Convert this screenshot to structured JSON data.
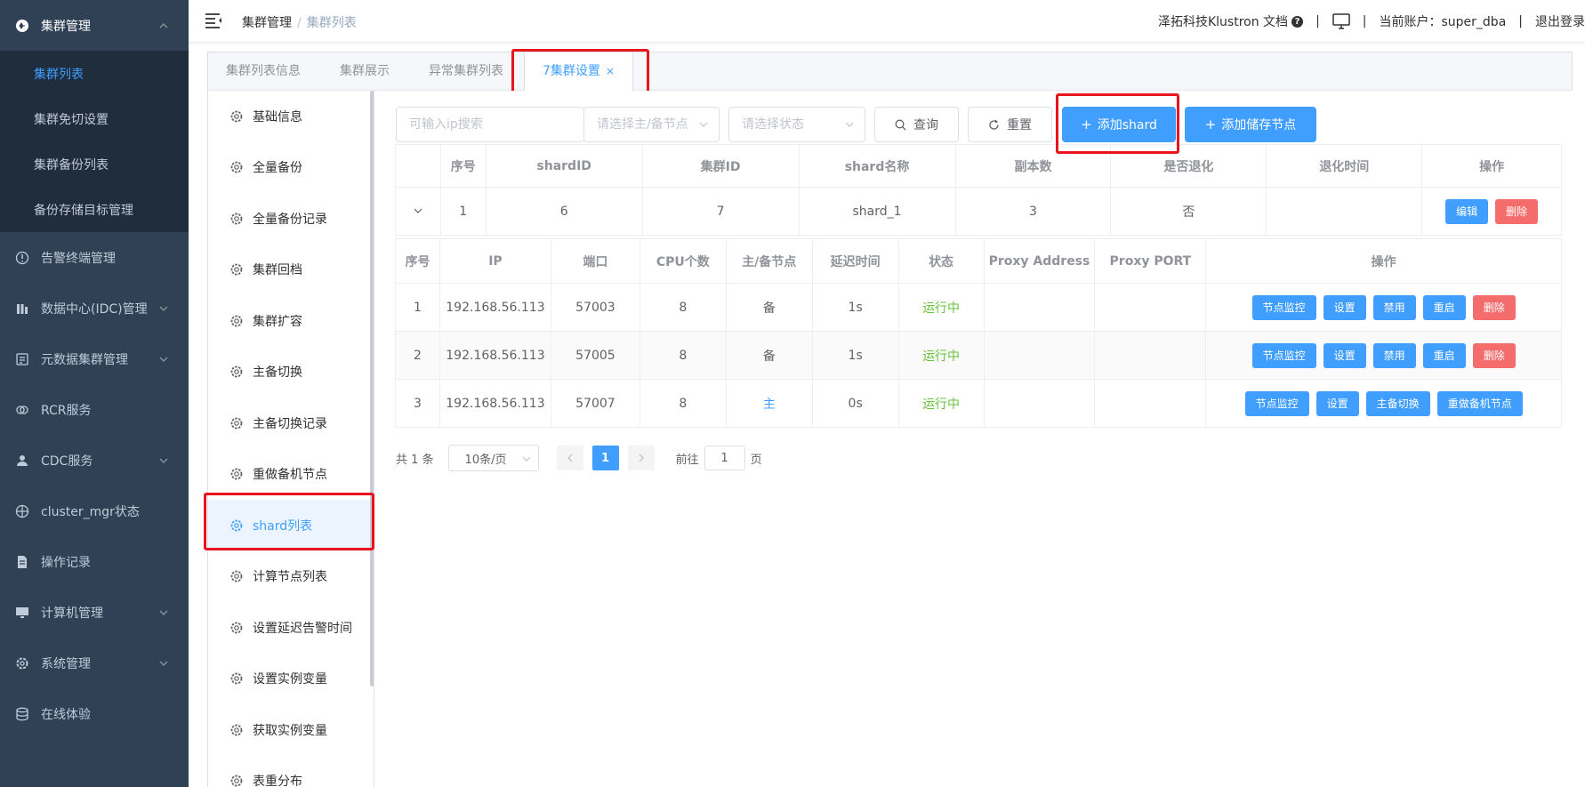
{
  "sidebar": {
    "top_menu": {
      "label": "集群管理",
      "icon": "cluster-icon"
    },
    "sub_items": [
      {
        "label": "集群列表",
        "active": true
      },
      {
        "label": "集群免切设置",
        "active": false
      },
      {
        "label": "集群备份列表",
        "active": false
      },
      {
        "label": "备份存储目标管理",
        "active": false
      }
    ],
    "items": [
      {
        "label": "告警终端管理",
        "icon": "alert-icon",
        "has_arrow": false
      },
      {
        "label": "数据中心(IDC)管理",
        "icon": "datacenter-icon",
        "has_arrow": true
      },
      {
        "label": "元数据集群管理",
        "icon": "metadata-icon",
        "has_arrow": true
      },
      {
        "label": "RCR服务",
        "icon": "link-icon",
        "has_arrow": false
      },
      {
        "label": "CDC服务",
        "icon": "user-icon",
        "has_arrow": true
      },
      {
        "label": "cluster_mgr状态",
        "icon": "target-icon",
        "has_arrow": false
      },
      {
        "label": "操作记录",
        "icon": "document-icon",
        "has_arrow": false
      },
      {
        "label": "计算机管理",
        "icon": "monitor-icon",
        "has_arrow": true
      },
      {
        "label": "系统管理",
        "icon": "settings-icon",
        "has_arrow": true
      },
      {
        "label": "在线体验",
        "icon": "database-icon",
        "has_arrow": false
      }
    ]
  },
  "header": {
    "breadcrumb_main": "集群管理",
    "breadcrumb_sep": "/",
    "breadcrumb_current": "集群列表",
    "docs_label": "泽拓科技Klustron 文档",
    "help_glyph": "?",
    "divider": "|",
    "account_label": "当前账户：super_dba",
    "logout_label": "退出登录"
  },
  "tabs": [
    {
      "label": "集群列表信息",
      "active": false
    },
    {
      "label": "集群展示",
      "active": false
    },
    {
      "label": "异常集群列表",
      "active": false
    },
    {
      "label": "7集群设置",
      "active": true,
      "close": "×"
    }
  ],
  "inner_menu": [
    {
      "label": "基础信息",
      "active": false
    },
    {
      "label": "全量备份",
      "active": false
    },
    {
      "label": "全量备份记录",
      "active": false
    },
    {
      "label": "集群回档",
      "active": false
    },
    {
      "label": "集群扩容",
      "active": false
    },
    {
      "label": "主备切换",
      "active": false
    },
    {
      "label": "主备切换记录",
      "active": false
    },
    {
      "label": "重做备机节点",
      "active": false
    },
    {
      "label": "shard列表",
      "active": true
    },
    {
      "label": "计算节点列表",
      "active": false
    },
    {
      "label": "设置延迟告警时间",
      "active": false
    },
    {
      "label": "设置实例变量",
      "active": false
    },
    {
      "label": "获取实例变量",
      "active": false
    },
    {
      "label": "表重分布",
      "active": false
    }
  ],
  "toolbar": {
    "ip_placeholder": "可输入ip搜索",
    "node_type_placeholder": "请选择主/备节点",
    "status_placeholder": "请选择状态",
    "query_label": "查询",
    "reset_label": "重置",
    "add_shard_label": "添加shard",
    "add_storage_label": "添加储存节点"
  },
  "shard_table": {
    "headers": [
      "序号",
      "shardID",
      "集群ID",
      "shard名称",
      "副本数",
      "是否退化",
      "退化时间",
      "操作"
    ],
    "row": {
      "index": "1",
      "shard_id": "6",
      "cluster_id": "7",
      "name": "shard_1",
      "replicas": "3",
      "degraded": "否",
      "degraded_time": "",
      "edit": "编辑",
      "delete": "删除"
    }
  },
  "node_table": {
    "headers": [
      "序号",
      "IP",
      "端口",
      "CPU个数",
      "主/备节点",
      "延迟时间",
      "状态",
      "Proxy Address",
      "Proxy PORT",
      "操作"
    ],
    "rows": [
      {
        "index": "1",
        "ip": "192.168.56.113",
        "port": "57003",
        "cpu": "8",
        "role": "备",
        "delay": "1s",
        "status": "运行中",
        "proxy_addr": "",
        "proxy_port": "",
        "actions": [
          "节点监控",
          "设置",
          "禁用",
          "重启",
          "删除"
        ]
      },
      {
        "index": "2",
        "ip": "192.168.56.113",
        "port": "57005",
        "cpu": "8",
        "role": "备",
        "delay": "1s",
        "status": "运行中",
        "proxy_addr": "",
        "proxy_port": "",
        "actions": [
          "节点监控",
          "设置",
          "禁用",
          "重启",
          "删除"
        ]
      },
      {
        "index": "3",
        "ip": "192.168.56.113",
        "port": "57007",
        "cpu": "8",
        "role": "主",
        "delay": "0s",
        "status": "运行中",
        "proxy_addr": "",
        "proxy_port": "",
        "actions": [
          "节点监控",
          "设置",
          "主备切换",
          "重做备机节点"
        ]
      }
    ]
  },
  "pagination": {
    "total": "共 1 条",
    "page_size": "10条/页",
    "current_page": "1",
    "goto_label": "前往",
    "goto_value": "1",
    "page_unit": "页"
  },
  "colors": {
    "primary": "#409eff",
    "danger": "#f56c6c",
    "success": "#67c23a",
    "sidebar_bg": "#304156",
    "highlight": "#e8151d"
  }
}
